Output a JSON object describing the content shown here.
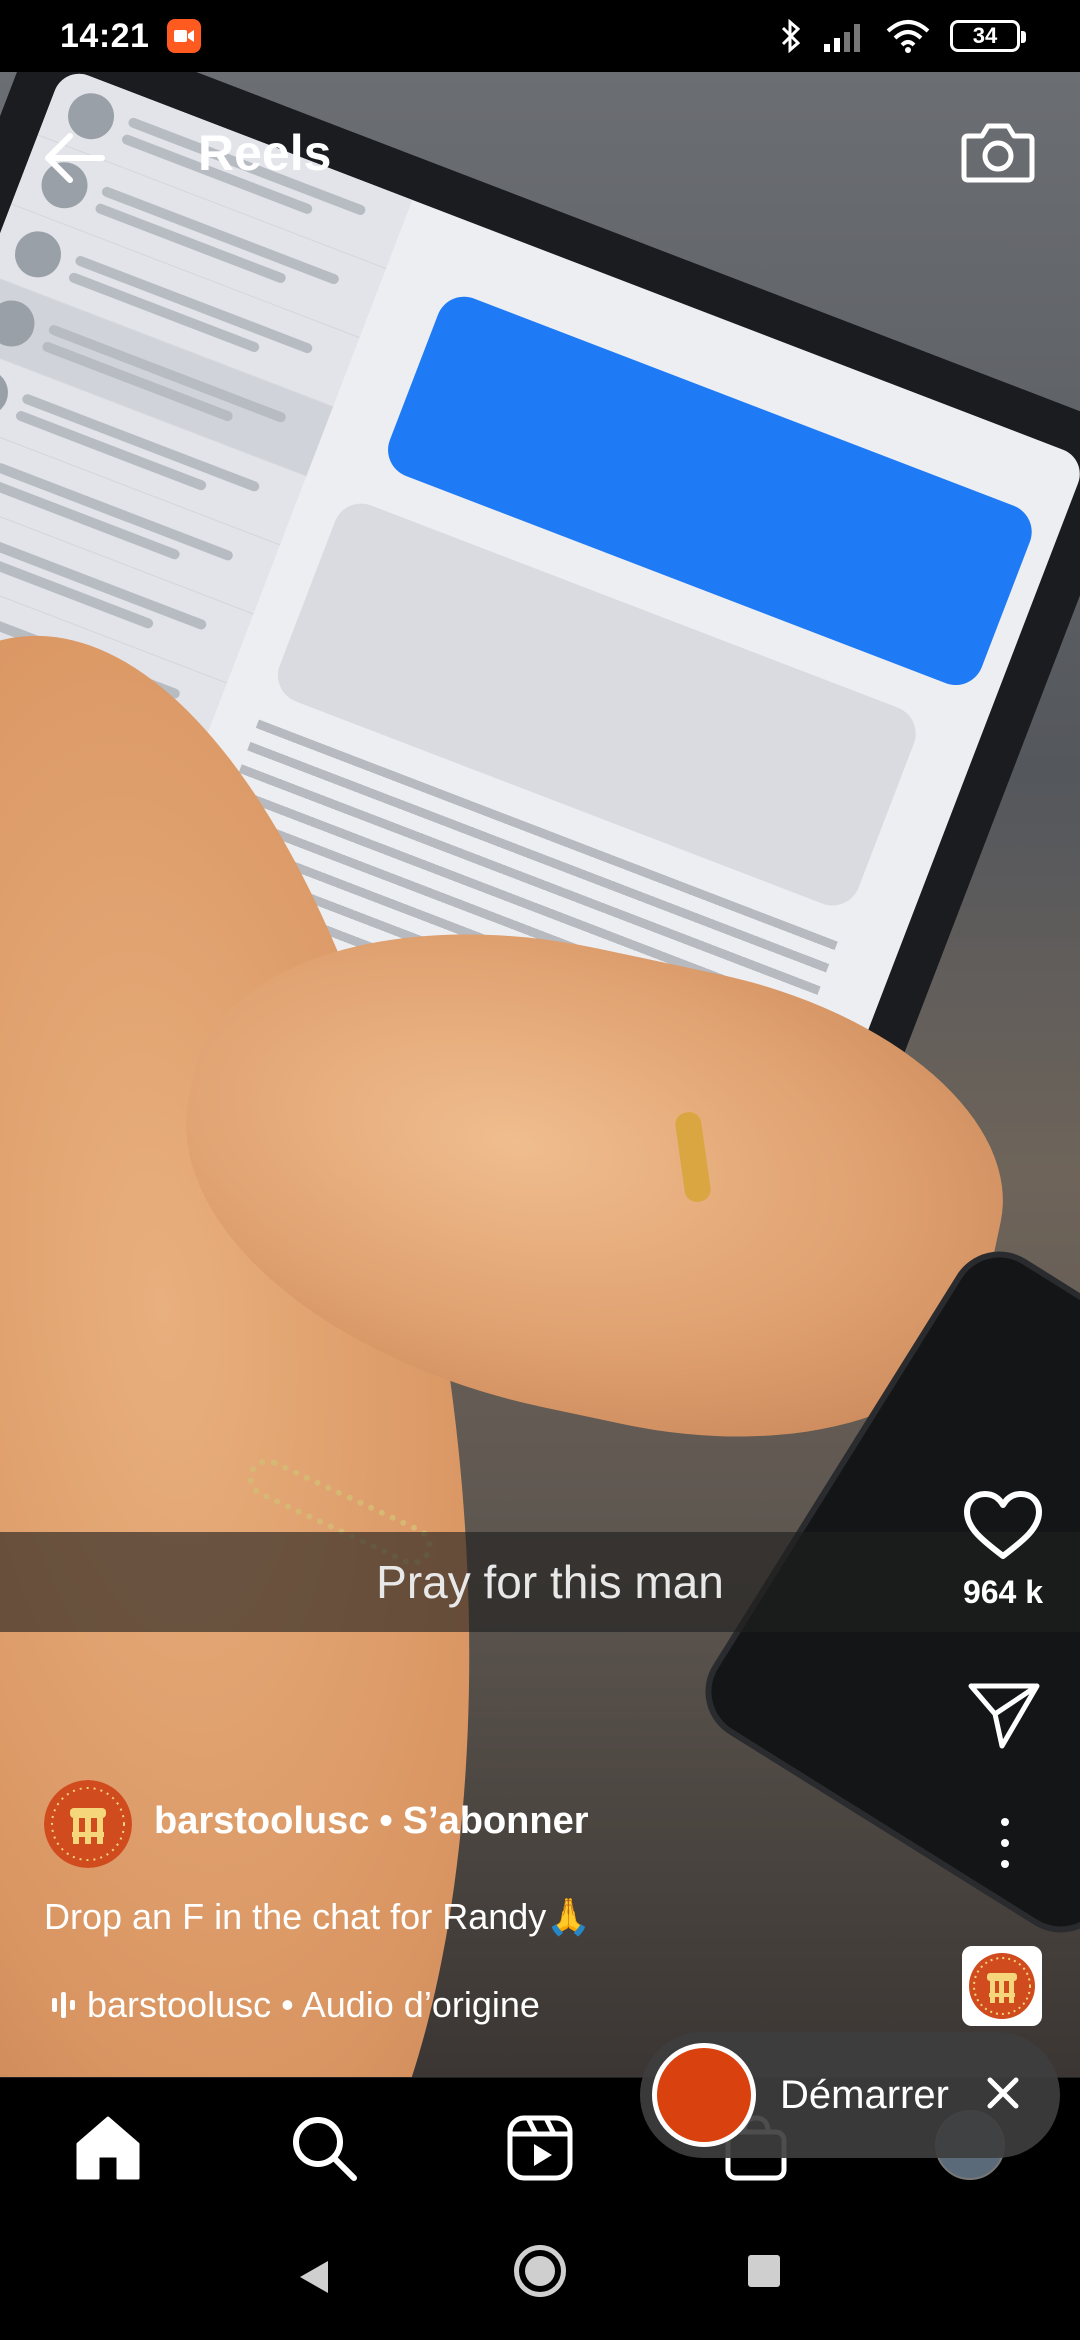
{
  "status_bar": {
    "time": "14:21",
    "battery": "34",
    "icons": [
      "screen-record-icon",
      "bluetooth-icon",
      "signal-icon",
      "wifi-icon",
      "battery-icon"
    ]
  },
  "header": {
    "title": "Reels",
    "back_icon": "arrow-left-icon",
    "camera_icon": "camera-icon"
  },
  "video": {
    "caption_overlay": "Pray for this man"
  },
  "right_rail": {
    "like_count": "964 k",
    "like_icon": "heart-icon",
    "share_icon": "paper-plane-icon",
    "more_icon": "more-vertical-icon"
  },
  "post": {
    "username": "barstoolusc",
    "separator": "•",
    "follow_label": "S’abonner",
    "caption": "Drop an F in the chat for Randy🙏",
    "audio_text": "barstoolusc • Audio d’origine"
  },
  "start_pill": {
    "label": "Démarrer",
    "close_icon": "close-icon"
  },
  "bottom_nav": {
    "items": [
      "home-icon",
      "search-icon",
      "reels-icon",
      "shop-icon",
      "profile-avatar"
    ]
  },
  "system_nav": {
    "items": [
      "back-triangle",
      "home-circle",
      "recents-square"
    ]
  },
  "colors": {
    "record_orange": "#d9410f",
    "status_record": "#ff5a1f"
  }
}
